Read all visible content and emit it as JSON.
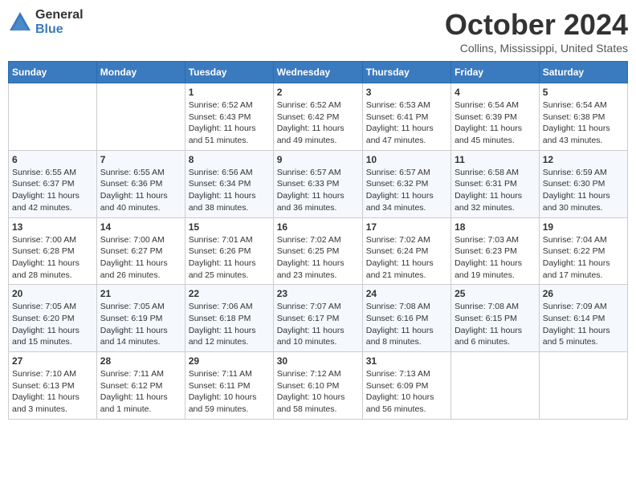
{
  "logo": {
    "general": "General",
    "blue": "Blue"
  },
  "title": "October 2024",
  "location": "Collins, Mississippi, United States",
  "days_of_week": [
    "Sunday",
    "Monday",
    "Tuesday",
    "Wednesday",
    "Thursday",
    "Friday",
    "Saturday"
  ],
  "weeks": [
    [
      {
        "day": "",
        "sunrise": "",
        "sunset": "",
        "daylight": ""
      },
      {
        "day": "",
        "sunrise": "",
        "sunset": "",
        "daylight": ""
      },
      {
        "day": "1",
        "sunrise": "Sunrise: 6:52 AM",
        "sunset": "Sunset: 6:43 PM",
        "daylight": "Daylight: 11 hours and 51 minutes."
      },
      {
        "day": "2",
        "sunrise": "Sunrise: 6:52 AM",
        "sunset": "Sunset: 6:42 PM",
        "daylight": "Daylight: 11 hours and 49 minutes."
      },
      {
        "day": "3",
        "sunrise": "Sunrise: 6:53 AM",
        "sunset": "Sunset: 6:41 PM",
        "daylight": "Daylight: 11 hours and 47 minutes."
      },
      {
        "day": "4",
        "sunrise": "Sunrise: 6:54 AM",
        "sunset": "Sunset: 6:39 PM",
        "daylight": "Daylight: 11 hours and 45 minutes."
      },
      {
        "day": "5",
        "sunrise": "Sunrise: 6:54 AM",
        "sunset": "Sunset: 6:38 PM",
        "daylight": "Daylight: 11 hours and 43 minutes."
      }
    ],
    [
      {
        "day": "6",
        "sunrise": "Sunrise: 6:55 AM",
        "sunset": "Sunset: 6:37 PM",
        "daylight": "Daylight: 11 hours and 42 minutes."
      },
      {
        "day": "7",
        "sunrise": "Sunrise: 6:55 AM",
        "sunset": "Sunset: 6:36 PM",
        "daylight": "Daylight: 11 hours and 40 minutes."
      },
      {
        "day": "8",
        "sunrise": "Sunrise: 6:56 AM",
        "sunset": "Sunset: 6:34 PM",
        "daylight": "Daylight: 11 hours and 38 minutes."
      },
      {
        "day": "9",
        "sunrise": "Sunrise: 6:57 AM",
        "sunset": "Sunset: 6:33 PM",
        "daylight": "Daylight: 11 hours and 36 minutes."
      },
      {
        "day": "10",
        "sunrise": "Sunrise: 6:57 AM",
        "sunset": "Sunset: 6:32 PM",
        "daylight": "Daylight: 11 hours and 34 minutes."
      },
      {
        "day": "11",
        "sunrise": "Sunrise: 6:58 AM",
        "sunset": "Sunset: 6:31 PM",
        "daylight": "Daylight: 11 hours and 32 minutes."
      },
      {
        "day": "12",
        "sunrise": "Sunrise: 6:59 AM",
        "sunset": "Sunset: 6:30 PM",
        "daylight": "Daylight: 11 hours and 30 minutes."
      }
    ],
    [
      {
        "day": "13",
        "sunrise": "Sunrise: 7:00 AM",
        "sunset": "Sunset: 6:28 PM",
        "daylight": "Daylight: 11 hours and 28 minutes."
      },
      {
        "day": "14",
        "sunrise": "Sunrise: 7:00 AM",
        "sunset": "Sunset: 6:27 PM",
        "daylight": "Daylight: 11 hours and 26 minutes."
      },
      {
        "day": "15",
        "sunrise": "Sunrise: 7:01 AM",
        "sunset": "Sunset: 6:26 PM",
        "daylight": "Daylight: 11 hours and 25 minutes."
      },
      {
        "day": "16",
        "sunrise": "Sunrise: 7:02 AM",
        "sunset": "Sunset: 6:25 PM",
        "daylight": "Daylight: 11 hours and 23 minutes."
      },
      {
        "day": "17",
        "sunrise": "Sunrise: 7:02 AM",
        "sunset": "Sunset: 6:24 PM",
        "daylight": "Daylight: 11 hours and 21 minutes."
      },
      {
        "day": "18",
        "sunrise": "Sunrise: 7:03 AM",
        "sunset": "Sunset: 6:23 PM",
        "daylight": "Daylight: 11 hours and 19 minutes."
      },
      {
        "day": "19",
        "sunrise": "Sunrise: 7:04 AM",
        "sunset": "Sunset: 6:22 PM",
        "daylight": "Daylight: 11 hours and 17 minutes."
      }
    ],
    [
      {
        "day": "20",
        "sunrise": "Sunrise: 7:05 AM",
        "sunset": "Sunset: 6:20 PM",
        "daylight": "Daylight: 11 hours and 15 minutes."
      },
      {
        "day": "21",
        "sunrise": "Sunrise: 7:05 AM",
        "sunset": "Sunset: 6:19 PM",
        "daylight": "Daylight: 11 hours and 14 minutes."
      },
      {
        "day": "22",
        "sunrise": "Sunrise: 7:06 AM",
        "sunset": "Sunset: 6:18 PM",
        "daylight": "Daylight: 11 hours and 12 minutes."
      },
      {
        "day": "23",
        "sunrise": "Sunrise: 7:07 AM",
        "sunset": "Sunset: 6:17 PM",
        "daylight": "Daylight: 11 hours and 10 minutes."
      },
      {
        "day": "24",
        "sunrise": "Sunrise: 7:08 AM",
        "sunset": "Sunset: 6:16 PM",
        "daylight": "Daylight: 11 hours and 8 minutes."
      },
      {
        "day": "25",
        "sunrise": "Sunrise: 7:08 AM",
        "sunset": "Sunset: 6:15 PM",
        "daylight": "Daylight: 11 hours and 6 minutes."
      },
      {
        "day": "26",
        "sunrise": "Sunrise: 7:09 AM",
        "sunset": "Sunset: 6:14 PM",
        "daylight": "Daylight: 11 hours and 5 minutes."
      }
    ],
    [
      {
        "day": "27",
        "sunrise": "Sunrise: 7:10 AM",
        "sunset": "Sunset: 6:13 PM",
        "daylight": "Daylight: 11 hours and 3 minutes."
      },
      {
        "day": "28",
        "sunrise": "Sunrise: 7:11 AM",
        "sunset": "Sunset: 6:12 PM",
        "daylight": "Daylight: 11 hours and 1 minute."
      },
      {
        "day": "29",
        "sunrise": "Sunrise: 7:11 AM",
        "sunset": "Sunset: 6:11 PM",
        "daylight": "Daylight: 10 hours and 59 minutes."
      },
      {
        "day": "30",
        "sunrise": "Sunrise: 7:12 AM",
        "sunset": "Sunset: 6:10 PM",
        "daylight": "Daylight: 10 hours and 58 minutes."
      },
      {
        "day": "31",
        "sunrise": "Sunrise: 7:13 AM",
        "sunset": "Sunset: 6:09 PM",
        "daylight": "Daylight: 10 hours and 56 minutes."
      },
      {
        "day": "",
        "sunrise": "",
        "sunset": "",
        "daylight": ""
      },
      {
        "day": "",
        "sunrise": "",
        "sunset": "",
        "daylight": ""
      }
    ]
  ]
}
